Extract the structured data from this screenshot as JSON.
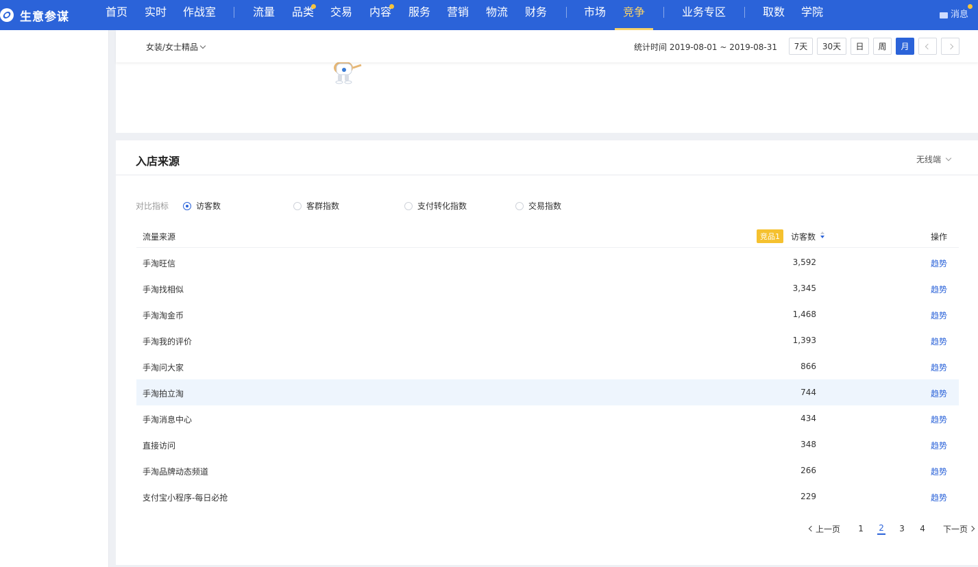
{
  "brand": {
    "name": "生意参谋"
  },
  "nav": {
    "items": [
      {
        "label": "首页"
      },
      {
        "label": "实时"
      },
      {
        "label": "作战室"
      },
      {
        "label": "流量"
      },
      {
        "label": "品类"
      },
      {
        "label": "交易"
      },
      {
        "label": "内容"
      },
      {
        "label": "服务"
      },
      {
        "label": "营销"
      },
      {
        "label": "物流"
      },
      {
        "label": "财务"
      },
      {
        "label": "市场"
      },
      {
        "label": "竞争"
      },
      {
        "label": "业务专区"
      },
      {
        "label": "取数"
      },
      {
        "label": "学院"
      }
    ],
    "active": "竞争",
    "message_label": "消息"
  },
  "filter": {
    "category": "女装/女士精品",
    "stat_time": "统计时间 2019-08-01 ~ 2019-08-31",
    "ranges": [
      "7天",
      "30天",
      "日",
      "周",
      "月"
    ],
    "active_range": "月"
  },
  "source_card": {
    "title": "入店来源",
    "device": "无线端",
    "metric_label": "对比指标",
    "metrics": [
      {
        "label": "访客数",
        "selected": true
      },
      {
        "label": "客群指数",
        "selected": false
      },
      {
        "label": "支付转化指数",
        "selected": false
      },
      {
        "label": "交易指数",
        "selected": false
      }
    ],
    "table": {
      "col_source": "流量来源",
      "badge": "竞品1",
      "col_value": "访客数",
      "col_action": "操作",
      "rows": [
        {
          "source": "手淘旺信",
          "value": "3,592",
          "action": "趋势"
        },
        {
          "source": "手淘找相似",
          "value": "3,345",
          "action": "趋势"
        },
        {
          "source": "手淘淘金币",
          "value": "1,468",
          "action": "趋势"
        },
        {
          "source": "手淘我的评价",
          "value": "1,393",
          "action": "趋势"
        },
        {
          "source": "手淘问大家",
          "value": "866",
          "action": "趋势"
        },
        {
          "source": "手淘拍立淘",
          "value": "744",
          "action": "趋势"
        },
        {
          "source": "手淘消息中心",
          "value": "434",
          "action": "趋势"
        },
        {
          "source": "直接访问",
          "value": "348",
          "action": "趋势"
        },
        {
          "source": "手淘品牌动态频道",
          "value": "266",
          "action": "趋势"
        },
        {
          "source": "支付宝小程序-每日必抢",
          "value": "229",
          "action": "趋势"
        }
      ]
    },
    "pager": {
      "prev": "上一页",
      "pages": [
        "1",
        "2",
        "3",
        "4"
      ],
      "current": "2",
      "next": "下一页"
    }
  },
  "colors": {
    "nav_bg": "#2b63d9",
    "active_nav": "#f6d26a",
    "badge": "#f5c12f",
    "link": "#2b63d9"
  }
}
